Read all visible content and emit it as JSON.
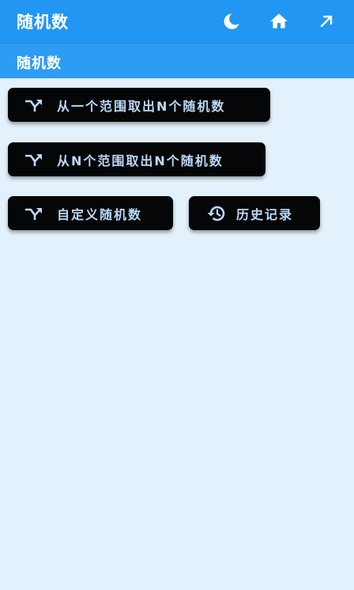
{
  "appbar": {
    "title": "随机数",
    "icons": [
      "moon-icon",
      "home-icon",
      "arrow-up-right-icon"
    ]
  },
  "subheader": {
    "title": "随机数"
  },
  "buttons": [
    {
      "label": "从一个范围取出N个随机数",
      "icon": "shuffle-icon"
    },
    {
      "label": "从N个范围取出N个随机数",
      "icon": "shuffle-icon"
    },
    {
      "label": "自定义随机数",
      "icon": "shuffle-icon"
    },
    {
      "label": "历史记录",
      "icon": "history-icon"
    }
  ],
  "colors": {
    "appbar": "#2196f3",
    "subheader": "#2f9cf3",
    "background": "#e3f1fc",
    "button_bg": "#050608",
    "button_text": "#bcd9f5"
  }
}
